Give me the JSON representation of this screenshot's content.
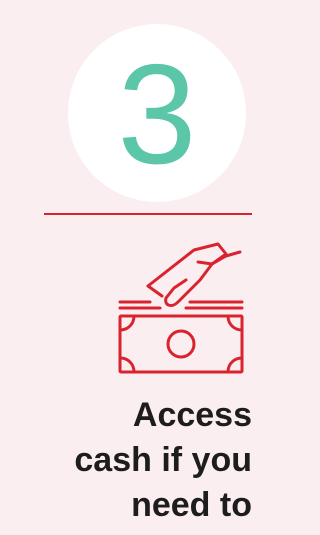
{
  "step": {
    "number": "3"
  },
  "caption": {
    "lines": [
      "Access",
      "cash if you",
      "need to"
    ]
  },
  "icons": {
    "cash": "hand-placing-cash-icon"
  },
  "colors": {
    "background": "#fbeef0",
    "circle": "#ffffff",
    "number": "#5bc7a8",
    "accent": "#d9232e",
    "text": "#1d1d1d"
  }
}
